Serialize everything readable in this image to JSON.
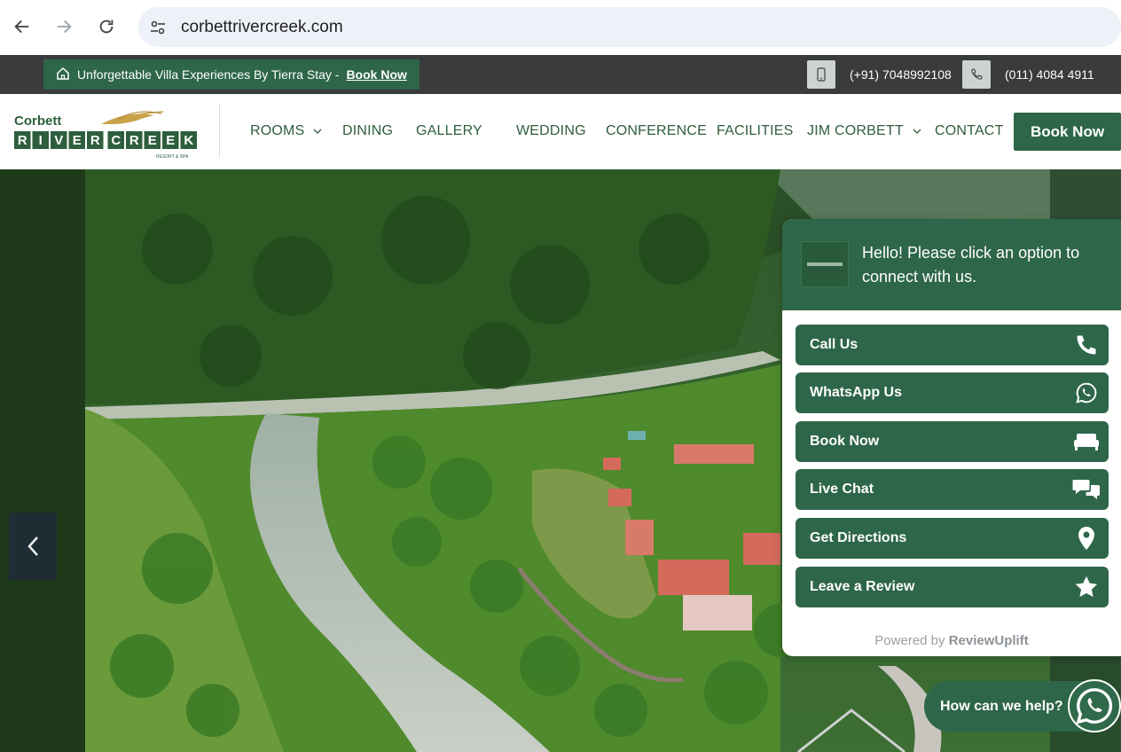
{
  "browser": {
    "url": "corbettrivercreek.com"
  },
  "topbar": {
    "promo_text": "Unforgettable Villa Experiences By Tierra Stay -",
    "promo_link": "Book Now",
    "mobile": "(+91) 7048992108",
    "landline": "(011) 4084 4911"
  },
  "logo": {
    "top": "Corbett",
    "letters": [
      "R",
      "I",
      "V",
      "E",
      "R",
      "C",
      "R",
      "E",
      "E",
      "K"
    ],
    "tag": "RESORT & SPA"
  },
  "nav": {
    "items": [
      {
        "label": "ROOMS",
        "dropdown": true
      },
      {
        "label": "DINING"
      },
      {
        "label": "GALLERY"
      },
      {
        "label": "WEDDING"
      },
      {
        "label": "CONFERENCE"
      },
      {
        "label": "FACILITIES"
      },
      {
        "label": "JIM CORBETT",
        "dropdown": true
      },
      {
        "label": "CONTACT"
      }
    ],
    "book_label": "Book Now"
  },
  "widget": {
    "greeting": "Hello! Please click an option to connect with us.",
    "options": [
      {
        "label": "Call Us",
        "icon": "phone-icon"
      },
      {
        "label": "WhatsApp Us",
        "icon": "whatsapp-icon"
      },
      {
        "label": "Book Now",
        "icon": "bed-icon"
      },
      {
        "label": "Live Chat",
        "icon": "chat-icon"
      },
      {
        "label": "Get Directions",
        "icon": "location-pin-icon"
      },
      {
        "label": "Leave a Review",
        "icon": "star-icon"
      }
    ],
    "powered_prefix": "Powered by",
    "powered_brand": "ReviewUplift"
  },
  "help": {
    "label": "How can we help?"
  },
  "colors": {
    "brand_green": "#2e6649",
    "topbar": "#393b3d"
  }
}
